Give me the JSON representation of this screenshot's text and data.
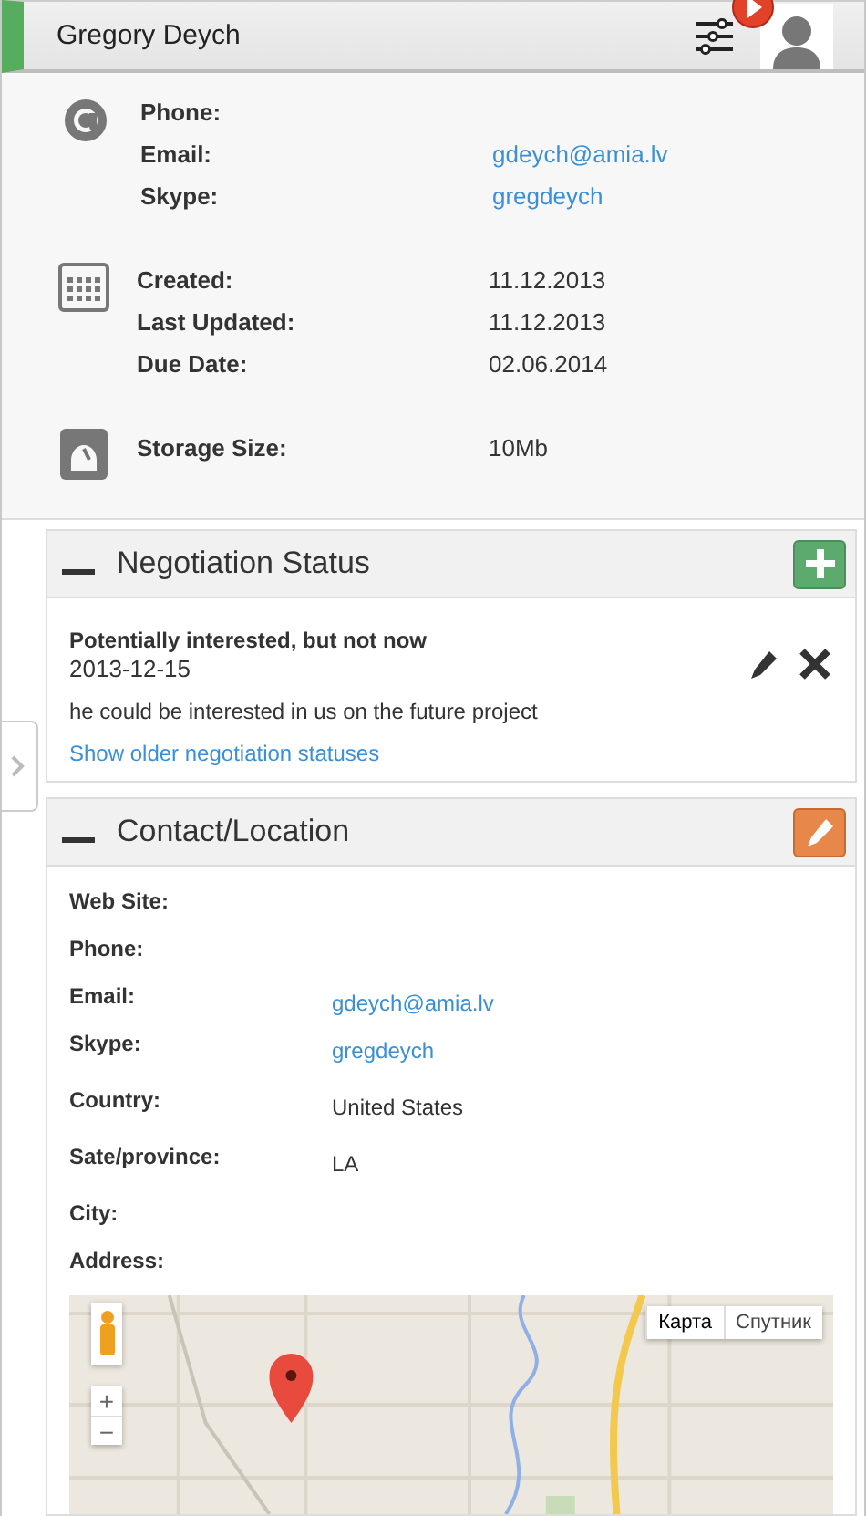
{
  "header": {
    "name": "Gregory Deych"
  },
  "info_groups": [
    {
      "kind": "contact",
      "rows": [
        {
          "label": "Phone:"
        },
        {
          "label": "Email:",
          "value": "gdeych@amia.lv",
          "link": true
        },
        {
          "label": "Skype:",
          "value": "gregdeych",
          "link": true
        }
      ]
    },
    {
      "kind": "dates",
      "rows": [
        {
          "label": "Created:",
          "value": "11.12.2013",
          "link": false
        },
        {
          "label": "Last Updated:",
          "value": "11.12.2013",
          "link": false
        },
        {
          "label": "Due Date:",
          "value": "02.06.2014",
          "link": false
        }
      ]
    },
    {
      "kind": "storage",
      "rows": [
        {
          "label": "Storage Size:",
          "value": "10Mb",
          "link": false
        }
      ]
    }
  ],
  "negotiation": {
    "title": "Negotiation Status",
    "status": "Potentially interested, but not now",
    "date": "2013-12-15",
    "note": "he could be interested in us on the future project",
    "older_link": "Show older negotiation statuses"
  },
  "contact_location": {
    "title": "Contact/Location",
    "rows": [
      {
        "label": "Web Site:"
      },
      {
        "label": "Phone:"
      },
      {
        "label": "Email:",
        "value": "gdeych@amia.lv",
        "link": true
      },
      {
        "label": "Skype:",
        "value": "gregdeych",
        "link": true
      },
      {
        "label": "Country:",
        "value": "United States",
        "link": false
      },
      {
        "label": "Sate/province:",
        "value": "LA",
        "link": false
      },
      {
        "label": "City:"
      },
      {
        "label": "Address:"
      }
    ],
    "map": {
      "kind": "picture",
      "zoom_in": "+",
      "zoom_out": "−",
      "types": [
        {
          "label": "Карта",
          "selected": true
        },
        {
          "label": "Спутник",
          "selected": false
        }
      ]
    }
  }
}
